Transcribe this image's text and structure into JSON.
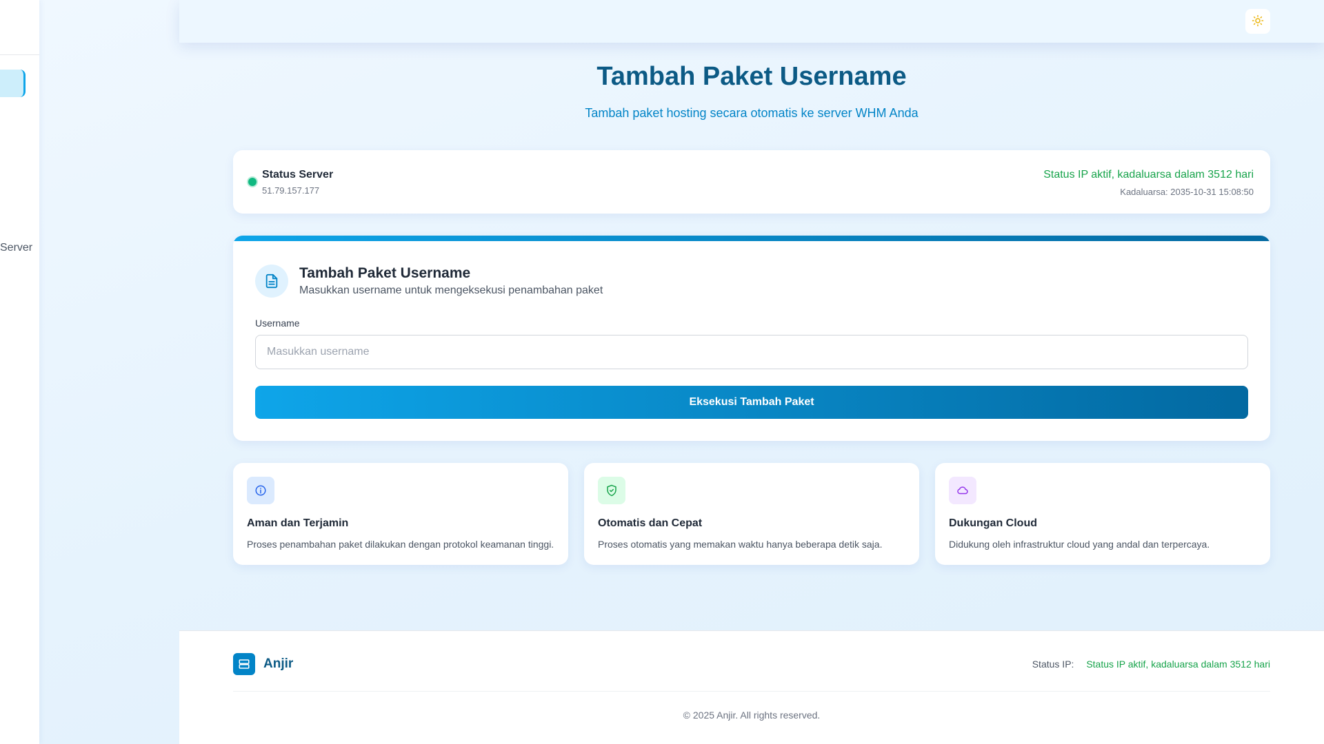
{
  "sidebar": {
    "partial_item_label": "Server"
  },
  "header": {
    "theme_toggle_icon": "sun-icon"
  },
  "page": {
    "title": "Tambah Paket Username",
    "subtitle": "Tambah paket hosting secara otomatis ke server WHM Anda"
  },
  "status": {
    "title": "Status Server",
    "ip": "51.79.157.177",
    "active_text": "Status IP aktif, kadaluarsa dalam 3512 hari",
    "expiry": "Kadaluarsa: 2035-10-31 15:08:50",
    "color": "#16a34a"
  },
  "form": {
    "title": "Tambah Paket Username",
    "subtitle": "Masukkan username untuk mengeksekusi penambahan paket",
    "label": "Username",
    "placeholder": "Masukkan username",
    "value": "",
    "submit_label": "Eksekusi Tambah Paket"
  },
  "features": [
    {
      "icon": "info-icon",
      "title": "Aman dan Terjamin",
      "desc": "Proses penambahan paket dilakukan dengan protokol keamanan tinggi."
    },
    {
      "icon": "shield-check-icon",
      "title": "Otomatis dan Cepat",
      "desc": "Proses otomatis yang memakan waktu hanya beberapa detik saja."
    },
    {
      "icon": "cloud-icon",
      "title": "Dukungan Cloud",
      "desc": "Didukung oleh infrastruktur cloud yang andal dan terpercaya."
    }
  ],
  "footer": {
    "brand": "Anjir",
    "status_label": "Status IP:",
    "status_value": "Status IP aktif, kadaluarsa dalam 3512 hari",
    "copyright": "© 2025 Anjir. All rights reserved."
  }
}
